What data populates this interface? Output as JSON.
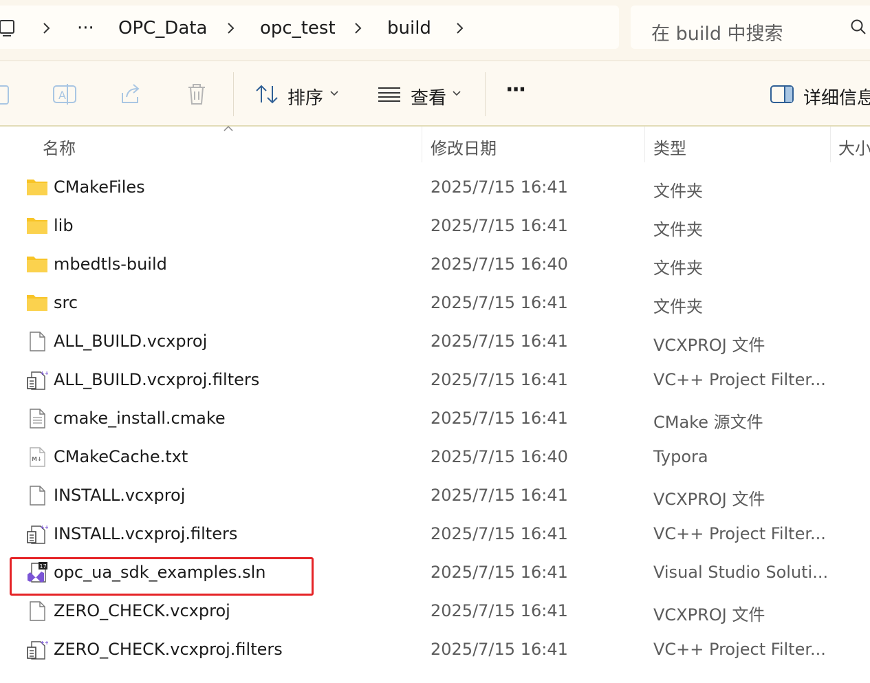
{
  "address_bar": {
    "crumbs": [
      "···",
      "OPC_Data",
      "opc_test",
      "build"
    ],
    "search_placeholder": "在 build 中搜索"
  },
  "command_bar": {
    "sort_label": "排序",
    "view_label": "查看",
    "more_label": "···",
    "details_label": "详细信息"
  },
  "columns": {
    "name": "名称",
    "date": "修改日期",
    "type": "类型",
    "size": "大小"
  },
  "files": [
    {
      "icon": "folder-icon",
      "name": "CMakeFiles",
      "date": "2025/7/15 16:41",
      "type": "文件夹"
    },
    {
      "icon": "folder-icon",
      "name": "lib",
      "date": "2025/7/15 16:41",
      "type": "文件夹"
    },
    {
      "icon": "folder-icon",
      "name": "mbedtls-build",
      "date": "2025/7/15 16:40",
      "type": "文件夹"
    },
    {
      "icon": "folder-icon",
      "name": "src",
      "date": "2025/7/15 16:41",
      "type": "文件夹"
    },
    {
      "icon": "blank-file-icon",
      "name": "ALL_BUILD.vcxproj",
      "date": "2025/7/15 16:41",
      "type": "VCXPROJ 文件"
    },
    {
      "icon": "vc-filters-file-icon",
      "name": "ALL_BUILD.vcxproj.filters",
      "date": "2025/7/15 16:41",
      "type": "VC++ Project Filter..."
    },
    {
      "icon": "text-file-icon",
      "name": "cmake_install.cmake",
      "date": "2025/7/15 16:41",
      "type": "CMake 源文件"
    },
    {
      "icon": "markdown-file-icon",
      "name": "CMakeCache.txt",
      "date": "2025/7/15 16:40",
      "type": "Typora"
    },
    {
      "icon": "blank-file-icon",
      "name": "INSTALL.vcxproj",
      "date": "2025/7/15 16:41",
      "type": "VCXPROJ 文件"
    },
    {
      "icon": "vc-filters-file-icon",
      "name": "INSTALL.vcxproj.filters",
      "date": "2025/7/15 16:41",
      "type": "VC++ Project Filter..."
    },
    {
      "icon": "visual-studio-solution-icon",
      "name": "opc_ua_sdk_examples.sln",
      "date": "2025/7/15 16:41",
      "type": "Visual Studio Soluti..."
    },
    {
      "icon": "blank-file-icon",
      "name": "ZERO_CHECK.vcxproj",
      "date": "2025/7/15 16:41",
      "type": "VCXPROJ 文件"
    },
    {
      "icon": "vc-filters-file-icon",
      "name": "ZERO_CHECK.vcxproj.filters",
      "date": "2025/7/15 16:41",
      "type": "VC++ Project Filter..."
    }
  ],
  "colors": {
    "highlight_box": "#e52427",
    "folder_yellow": "#f8c427",
    "vs_purple": "#7b55d6"
  }
}
